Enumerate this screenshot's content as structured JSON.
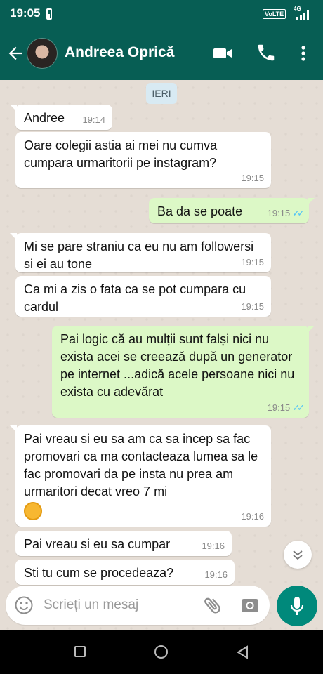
{
  "status_bar": {
    "time": "19:05",
    "volte": "VoLTE",
    "network": "4G"
  },
  "header": {
    "contact_name": "Andreea Oprică"
  },
  "chat": {
    "date_divider": "IERI",
    "messages": [
      {
        "dir": "in",
        "text": "Andree",
        "time": "19:14"
      },
      {
        "dir": "in",
        "text": "Oare colegii astia ai mei nu cumva cumpara urmaritorii pe instagram?",
        "time": "19:15"
      },
      {
        "dir": "out",
        "text": "Ba da se poate",
        "time": "19:15",
        "ticks": "✓✓"
      },
      {
        "dir": "in",
        "text": "Mi se pare straniu ca eu nu am followersi si ei au tone",
        "time": "19:15"
      },
      {
        "dir": "in",
        "text": "Ca mi a zis o fata ca se pot cumpara cu cardul",
        "time": "19:15"
      },
      {
        "dir": "out",
        "text": "Pai logic că au mulții sunt falși nici nu exista acei se creează după un generator pe internet ...adică acele persoane nici nu exista cu adevărat",
        "time": "19:15",
        "ticks": "✓✓"
      },
      {
        "dir": "in",
        "text": "Pai vreau si eu sa am ca sa incep sa fac promovari ca ma contacteaza lumea sa le fac promovari da pe insta nu prea am urmaritori decat vreo 7 mi",
        "time": "19:16",
        "emoji": "hugging-face"
      },
      {
        "dir": "in",
        "text": "Pai vreau si eu sa cumpar",
        "time": "19:16"
      },
      {
        "dir": "in",
        "text": "Sti tu cum se procedeaza?",
        "time": "19:16"
      }
    ]
  },
  "composer": {
    "placeholder": "Scrieți un mesaj"
  },
  "colors": {
    "header": "#075e54",
    "outgoing_bubble": "#dcf8c6",
    "chat_bg": "#e5ddd5",
    "mic_button": "#00897b",
    "read_ticks": "#4fc3f7"
  },
  "icons": [
    "back-arrow-icon",
    "video-call-icon",
    "phone-icon",
    "more-vert-icon",
    "emoji-icon",
    "attach-icon",
    "camera-icon",
    "mic-icon",
    "scroll-down-icon"
  ]
}
